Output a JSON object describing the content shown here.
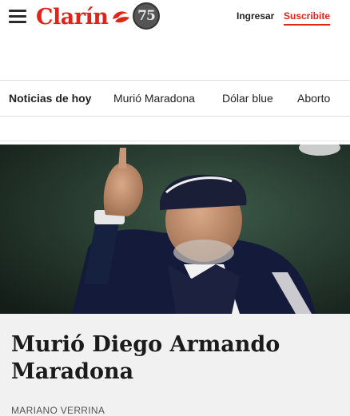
{
  "header": {
    "logo_text": "Clarín",
    "badge": "75",
    "login_label": "Ingresar",
    "subscribe_label": "Suscribite",
    "brand_color": "#e2231a"
  },
  "nav": {
    "items": [
      {
        "label": "Noticias de hoy"
      },
      {
        "label": "Murió Maradona"
      },
      {
        "label": "Dólar blue"
      },
      {
        "label": "Aborto"
      }
    ]
  },
  "article": {
    "headline": "Murió Diego Armando Maradona",
    "author": "MARIANO VERRINA"
  },
  "icons": {
    "menu": "hamburger-menu-icon",
    "logo_mark": "clarin-logo-mark-icon",
    "anniversary": "anniversary-75-badge-icon"
  }
}
